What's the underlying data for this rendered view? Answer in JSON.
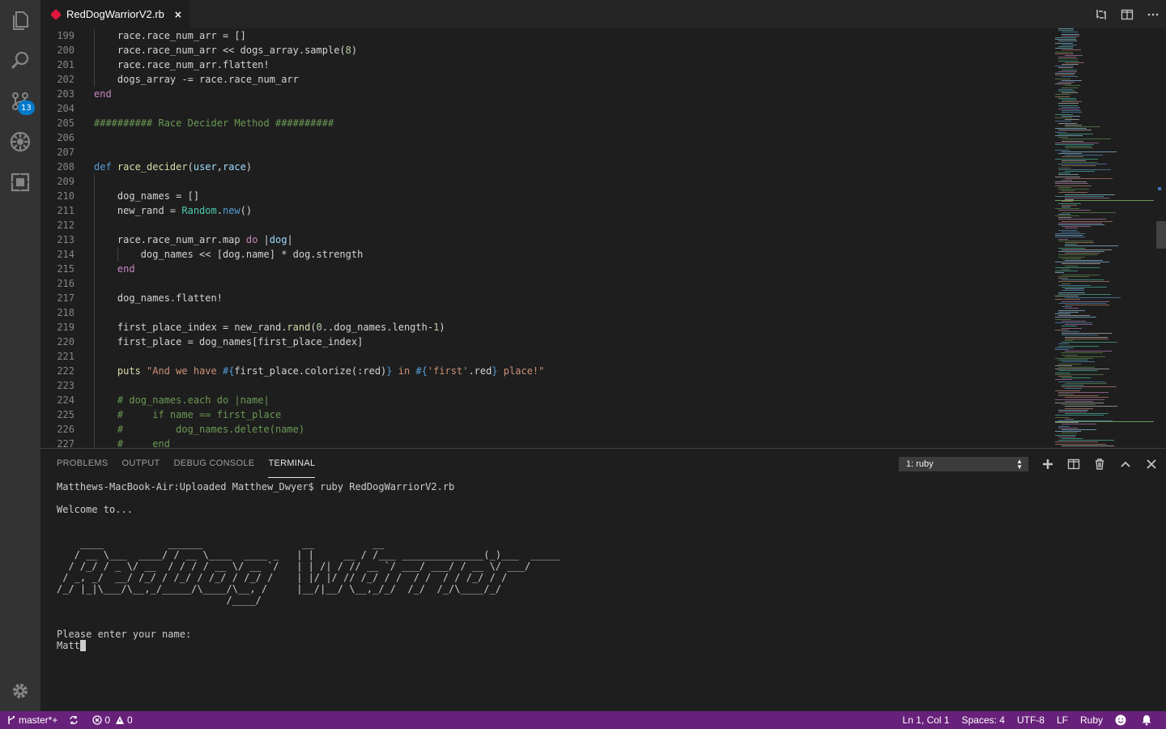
{
  "tab": {
    "filename": "RedDogWarriorV2.rb",
    "close": "×"
  },
  "activity": {
    "scm_badge": "13"
  },
  "editor": {
    "lines": [
      {
        "n": "199"
      },
      {
        "n": "200"
      },
      {
        "n": "201"
      },
      {
        "n": "202"
      },
      {
        "n": "203"
      },
      {
        "n": "204"
      },
      {
        "n": "205"
      },
      {
        "n": "206"
      },
      {
        "n": "207"
      },
      {
        "n": "208"
      },
      {
        "n": "209"
      },
      {
        "n": "210"
      },
      {
        "n": "211"
      },
      {
        "n": "212"
      },
      {
        "n": "213"
      },
      {
        "n": "214"
      },
      {
        "n": "215"
      },
      {
        "n": "216"
      },
      {
        "n": "217"
      },
      {
        "n": "218"
      },
      {
        "n": "219"
      },
      {
        "n": "220"
      },
      {
        "n": "221"
      },
      {
        "n": "222"
      },
      {
        "n": "223"
      },
      {
        "n": "224"
      },
      {
        "n": "225"
      },
      {
        "n": "226"
      },
      {
        "n": "227"
      }
    ],
    "code": [
      [
        [
          "    race.race_num_arr = []",
          "sym"
        ]
      ],
      [
        [
          "    race.race_num_arr << dogs_array.sample(",
          "sym"
        ],
        [
          "8",
          "num"
        ],
        [
          ")",
          "sym"
        ]
      ],
      [
        [
          "    race.race_num_arr.flatten!",
          "sym"
        ]
      ],
      [
        [
          "    dogs_array -= race.race_num_arr",
          "sym"
        ]
      ],
      [
        [
          "end",
          "k"
        ]
      ],
      [
        [
          "",
          ""
        ]
      ],
      [
        [
          "########## Race Decider Method ##########",
          "cm"
        ]
      ],
      [
        [
          "",
          ""
        ]
      ],
      [
        [
          "",
          ""
        ]
      ],
      [
        [
          "def ",
          "kw"
        ],
        [
          "race_decider",
          "fn"
        ],
        [
          "(",
          "sym"
        ],
        [
          "user",
          "var"
        ],
        [
          ",",
          "sym"
        ],
        [
          "race",
          "var"
        ],
        [
          ")",
          "sym"
        ]
      ],
      [
        [
          "",
          ""
        ]
      ],
      [
        [
          "    dog_names = []",
          "sym"
        ]
      ],
      [
        [
          "    new_rand = ",
          "sym"
        ],
        [
          "Random",
          "cls"
        ],
        [
          ".",
          "sym"
        ],
        [
          "new",
          "kw"
        ],
        [
          "()",
          "sym"
        ]
      ],
      [
        [
          "",
          ""
        ]
      ],
      [
        [
          "    race.race_num_arr.map ",
          "sym"
        ],
        [
          "do",
          "k"
        ],
        [
          " |",
          "sym"
        ],
        [
          "dog",
          "var"
        ],
        [
          "|",
          "sym"
        ]
      ],
      [
        [
          "        dog_names << [dog.name] * dog.strength",
          "sym"
        ]
      ],
      [
        [
          "    end",
          "k"
        ]
      ],
      [
        [
          "",
          ""
        ]
      ],
      [
        [
          "    dog_names.flatten!",
          "sym"
        ]
      ],
      [
        [
          "",
          ""
        ]
      ],
      [
        [
          "    first_place_index = new_rand.",
          "sym"
        ],
        [
          "rand",
          "fn"
        ],
        [
          "(",
          "sym"
        ],
        [
          "0",
          "num"
        ],
        [
          "..dog_names.length-",
          "sym"
        ],
        [
          "1",
          "num"
        ],
        [
          ")",
          "sym"
        ]
      ],
      [
        [
          "    first_place = dog_names[first_place_index]",
          "sym"
        ]
      ],
      [
        [
          "",
          ""
        ]
      ],
      [
        [
          "    ",
          "sym"
        ],
        [
          "puts",
          "fn"
        ],
        [
          " ",
          "sym"
        ],
        [
          "\"And we have ",
          "st"
        ],
        [
          "#{",
          "interp"
        ],
        [
          "first_place.colorize(:red)",
          "sym"
        ],
        [
          "}",
          "interp"
        ],
        [
          " in ",
          "st"
        ],
        [
          "#{",
          "interp"
        ],
        [
          "'first'",
          "st"
        ],
        [
          ".red",
          "sym"
        ],
        [
          "}",
          "interp"
        ],
        [
          " place!\"",
          "st"
        ]
      ],
      [
        [
          "",
          ""
        ]
      ],
      [
        [
          "    # dog_names.each do |name|",
          "cm"
        ]
      ],
      [
        [
          "    #     if name == first_place",
          "cm"
        ]
      ],
      [
        [
          "    #         dog_names.delete(name)",
          "cm"
        ]
      ],
      [
        [
          "    #     end",
          "cm"
        ]
      ]
    ]
  },
  "panel": {
    "tabs": [
      "PROBLEMS",
      "OUTPUT",
      "DEBUG CONSOLE",
      "TERMINAL"
    ],
    "terminal_select": "1: ruby",
    "terminal_lines": [
      "Matthews-MacBook-Air:Uploaded Matthew_Dwyer$ ruby RedDogWarriorV2.rb",
      "",
      "Welcome to...",
      "",
      "",
      "    ____           ______                 __          __",
      "   / __ \\___  ____/ / __ \\____  ____ _   | |     __ / /___ ______________(_)___  _____",
      "  / /_/ / _ \\/ __  / / / / __ \\/ __ `/   | | /| / // __ `/ ___/ ___/ / __ \\/ ___/",
      " / _, _/  __/ /_/ / /_/ / /_/ / /_/ /    | |/ |/ // /_/ / /  / /  / / /_/ / /",
      "/_/ |_|\\___/\\__,_/_____/\\____/\\__, /     |__/|__/ \\__,_/_/  /_/  /_/\\____/_/",
      "                             /____/",
      "",
      "",
      "Please enter your name:"
    ],
    "input_value": "Matt"
  },
  "status": {
    "branch": "master*+",
    "errors": "0",
    "warnings": "0",
    "position": "Ln 1, Col 1",
    "spaces": "Spaces: 4",
    "encoding": "UTF-8",
    "eol": "LF",
    "language": "Ruby"
  }
}
